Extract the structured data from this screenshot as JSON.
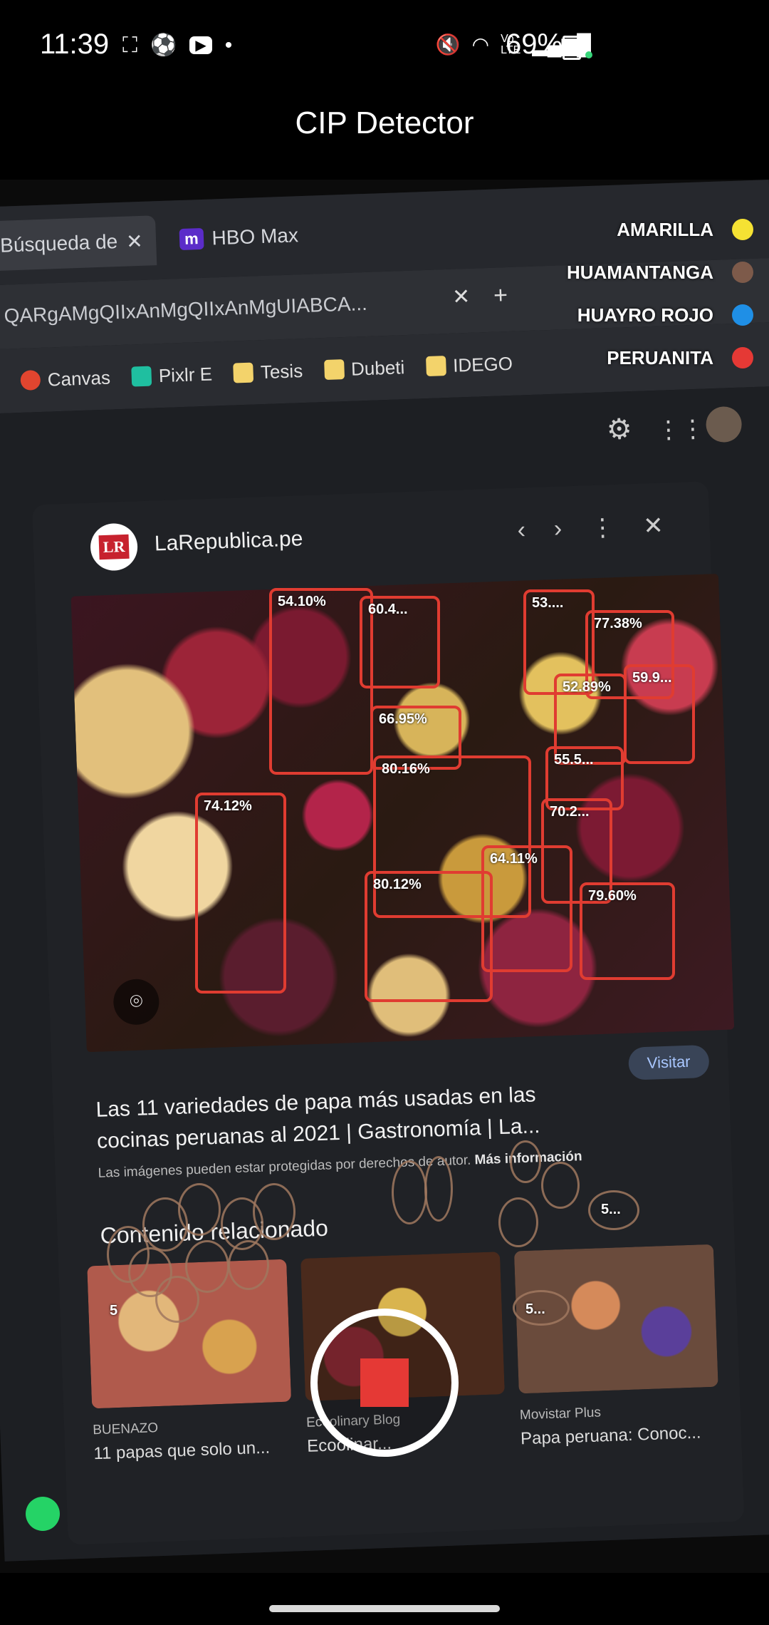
{
  "status_bar": {
    "time": "11:39",
    "left_icons": [
      "screenshot-icon",
      "soccer-ball-icon",
      "youtube-icon",
      "dot-icon"
    ],
    "right_icons": [
      "mute-icon",
      "wifi-icon",
      "volte-icon",
      "signal-icon"
    ],
    "battery": "69%"
  },
  "app": {
    "title": "CIP Detector"
  },
  "legend": [
    {
      "label": "AMARILLA",
      "color": "#f5e233"
    },
    {
      "label": "HUAMANTANGA",
      "color": "#7d5a4a"
    },
    {
      "label": "HUAYRO ROJO",
      "color": "#1f8fe6"
    },
    {
      "label": "PERUANITA",
      "color": "#e53935"
    }
  ],
  "browser": {
    "tabs": [
      {
        "label": "Búsqueda de",
        "close": "✕"
      },
      {
        "label": "HBO Max",
        "badge": "m"
      }
    ],
    "url": "QARgAMgQIIxAnMgQIIxAnMgUIABCA...",
    "bookmarks": [
      "Canvas",
      "Pixlr E",
      "Tesis",
      "Dubeti",
      "IDEGO"
    ]
  },
  "result": {
    "source": "LaRepublica.pe",
    "visit_label": "Visitar",
    "headline": "Las 11 variedades de papa más usadas en las cocinas peruanas al 2021 | Gastronomía | La...",
    "copyright": "Las imágenes pueden estar protegidas por derechos de autor.",
    "more_info": "Más información",
    "related_title": "Contenido relacionado",
    "related": [
      {
        "source": "BUENAZO",
        "title": "11 papas que solo un..."
      },
      {
        "source": "Ecoolinary Blog",
        "title": "Ecoolinar..."
      },
      {
        "source": "Movistar Plus",
        "title": "Papa peruana: Conoc..."
      }
    ]
  },
  "detections": [
    {
      "label": "54.10%"
    },
    {
      "label": "60.4..."
    },
    {
      "label": "53...."
    },
    {
      "label": "77.38%"
    },
    {
      "label": "59.9..."
    },
    {
      "label": "52.89%"
    },
    {
      "label": "66.95%"
    },
    {
      "label": "80.16%"
    },
    {
      "label": "55.5..."
    },
    {
      "label": "74.12%"
    },
    {
      "label": "70.2..."
    },
    {
      "label": "64.11%"
    },
    {
      "label": "80.12%"
    },
    {
      "label": "79.60%"
    }
  ],
  "faint_labels": [
    "5...",
    "5...",
    "5"
  ],
  "controls": {
    "record_state": "recording"
  }
}
